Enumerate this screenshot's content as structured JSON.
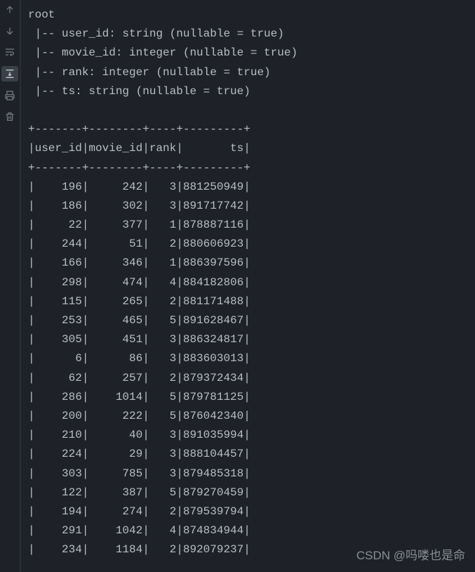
{
  "schema": {
    "root_label": "root",
    "fields": [
      {
        "name": "user_id",
        "type": "string",
        "nullable": "true"
      },
      {
        "name": "movie_id",
        "type": "integer",
        "nullable": "true"
      },
      {
        "name": "rank",
        "type": "integer",
        "nullable": "true"
      },
      {
        "name": "ts",
        "type": "string",
        "nullable": "true"
      }
    ]
  },
  "table": {
    "columns": [
      "user_id",
      "movie_id",
      "rank",
      "ts"
    ],
    "widths": [
      7,
      8,
      4,
      9
    ],
    "rows": [
      [
        "196",
        "242",
        "3",
        "881250949"
      ],
      [
        "186",
        "302",
        "3",
        "891717742"
      ],
      [
        "22",
        "377",
        "1",
        "878887116"
      ],
      [
        "244",
        "51",
        "2",
        "880606923"
      ],
      [
        "166",
        "346",
        "1",
        "886397596"
      ],
      [
        "298",
        "474",
        "4",
        "884182806"
      ],
      [
        "115",
        "265",
        "2",
        "881171488"
      ],
      [
        "253",
        "465",
        "5",
        "891628467"
      ],
      [
        "305",
        "451",
        "3",
        "886324817"
      ],
      [
        "6",
        "86",
        "3",
        "883603013"
      ],
      [
        "62",
        "257",
        "2",
        "879372434"
      ],
      [
        "286",
        "1014",
        "5",
        "879781125"
      ],
      [
        "200",
        "222",
        "5",
        "876042340"
      ],
      [
        "210",
        "40",
        "3",
        "891035994"
      ],
      [
        "224",
        "29",
        "3",
        "888104457"
      ],
      [
        "303",
        "785",
        "3",
        "879485318"
      ],
      [
        "122",
        "387",
        "5",
        "879270459"
      ],
      [
        "194",
        "274",
        "2",
        "879539794"
      ],
      [
        "291",
        "1042",
        "4",
        "874834944"
      ],
      [
        "234",
        "1184",
        "2",
        "892079237"
      ]
    ]
  },
  "watermark": "CSDN @吗喽也是命"
}
